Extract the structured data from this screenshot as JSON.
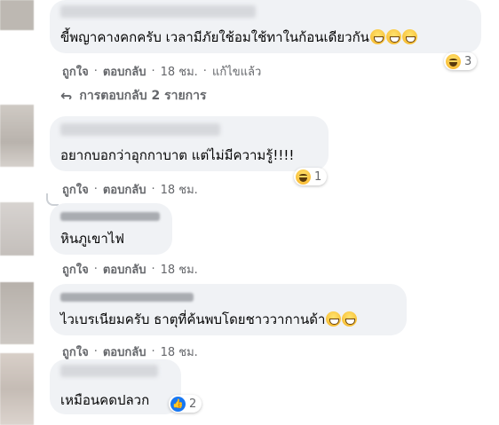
{
  "comments": [
    {
      "text": "ขี้พญาคางคกครับ เวลามีภัยใช้อมใช้ทาในก้อนเดียวกัน",
      "like": "ถูกใจ",
      "reply": "ตอบกลับ",
      "time": "18 ชม.",
      "edited": "แก้ไขแล้ว",
      "reaction_count": "3",
      "reaction_icon": "haha"
    },
    {
      "text": "อยากบอกว่าอุกกาบาต แต่ไม่มีความรู้!!!!",
      "like": "ถูกใจ",
      "reply": "ตอบกลับ",
      "time": "18 ชม.",
      "reaction_count": "1",
      "reaction_icon": "haha"
    },
    {
      "text": "หินภูเขาไฟ",
      "like": "ถูกใจ",
      "reply": "ตอบกลับ",
      "time": "18 ชม."
    },
    {
      "text": "ไวเบรเนียมครับ ธาตุที่ค้นพบโดยชาววากานด้า",
      "like": "ถูกใจ",
      "reply": "ตอบกลับ",
      "time": "18 ชม."
    },
    {
      "text": "เหมือนคดปลวก",
      "reaction_count": "2",
      "reaction_icon": "like"
    }
  ],
  "replies_label": "การตอบกลับ 2 รายการ",
  "separator": "·",
  "colors": {
    "bubble": "#f0f2f5",
    "meta": "#65676b",
    "like_blue": "#1877f2"
  }
}
